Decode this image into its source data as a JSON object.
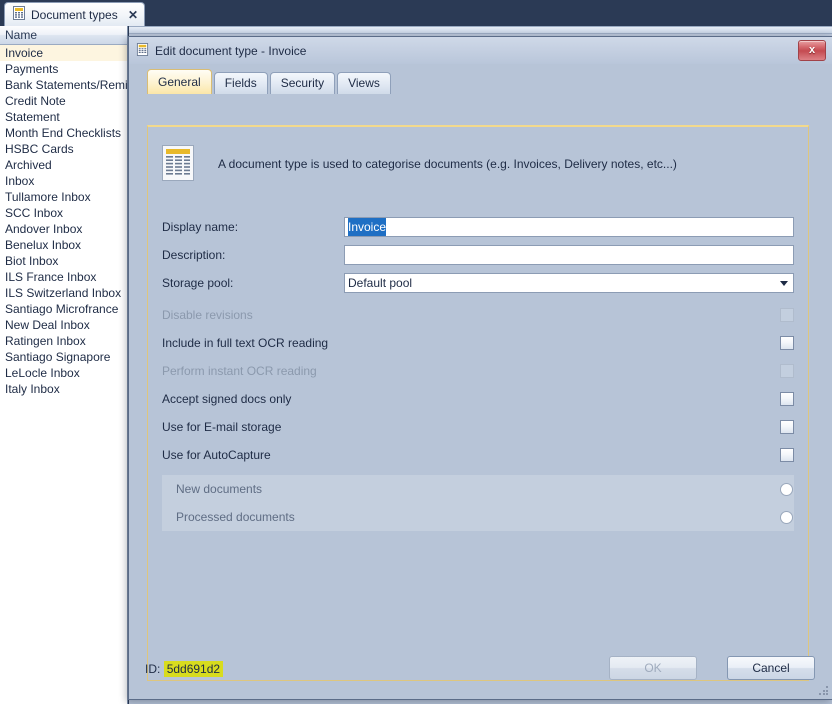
{
  "app": {
    "tab": {
      "icon": "document-types-icon",
      "label": "Document types",
      "close_label": "✕"
    }
  },
  "list_panel": {
    "header": "Name",
    "selected_index": 0,
    "items": [
      "Invoice",
      "Payments",
      "Bank Statements/Remitt",
      "Credit Note",
      "Statement",
      "Month End Checklists",
      "HSBC Cards",
      "Archived",
      "Inbox",
      "Tullamore Inbox",
      "SCC Inbox",
      "Andover Inbox",
      "Benelux Inbox",
      "Biot Inbox",
      "ILS France Inbox",
      "ILS Switzerland Inbox",
      "Santiago Microfrance",
      "New Deal Inbox",
      "Ratingen Inbox",
      "Santiago Signapore",
      "LeLocle Inbox",
      "Italy Inbox"
    ]
  },
  "dialog": {
    "icon": "document-type-icon",
    "title": "Edit document type - Invoice",
    "close_label": "x",
    "tabs": [
      {
        "label": "General",
        "active": true
      },
      {
        "label": "Fields",
        "active": false
      },
      {
        "label": "Security",
        "active": false
      },
      {
        "label": "Views",
        "active": false
      }
    ],
    "description": "A document type is used to categorise documents (e.g. Invoices, Delivery notes, etc...)",
    "description_icon": "document-page-icon",
    "fields": [
      {
        "label": "Display name:",
        "value": "Invoice",
        "selected": true,
        "type": "text"
      },
      {
        "label": "Description:",
        "value": "",
        "selected": false,
        "type": "text"
      },
      {
        "label": "Storage pool:",
        "value": "Default pool",
        "selected": false,
        "type": "combo"
      }
    ],
    "checkboxes": [
      {
        "label": "Disable revisions",
        "checked": false,
        "disabled": true
      },
      {
        "label": "Include in full text OCR reading",
        "checked": false,
        "disabled": false
      },
      {
        "label": "Perform instant OCR reading",
        "checked": false,
        "disabled": true
      },
      {
        "label": "Accept signed docs only",
        "checked": false,
        "disabled": false
      },
      {
        "label": "Use for E-mail storage",
        "checked": false,
        "disabled": false
      },
      {
        "label": "Use for AutoCapture",
        "checked": false,
        "disabled": false
      }
    ],
    "radios": [
      {
        "label": "New documents",
        "checked": false
      },
      {
        "label": "Processed documents",
        "checked": false
      }
    ],
    "footer": {
      "id_label": "ID:",
      "id_value": "5dd691d2",
      "ok_label": "OK",
      "cancel_label": "Cancel",
      "ok_disabled": true
    }
  },
  "colors": {
    "window_chrome": "#2b3a55",
    "dialog_body": "#b7c4d7",
    "tab_accent": "#f2d98c",
    "selection_blue": "#1e6fc4",
    "highlight_yellow": "#d8dc1e",
    "list_selected": "#fdf5e0",
    "close_red": "#c44a50"
  }
}
